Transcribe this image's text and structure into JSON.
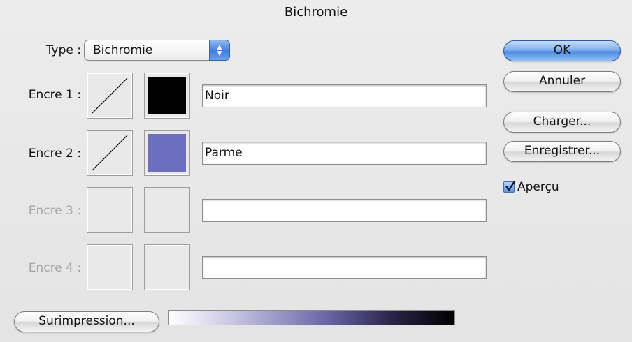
{
  "dialog": {
    "title": "Bichromie"
  },
  "type_row": {
    "label": "Type :",
    "selected": "Bichromie"
  },
  "inks": [
    {
      "label": "Encre 1 :",
      "name": "Noir",
      "color": "#000000",
      "enabled": true
    },
    {
      "label": "Encre 2 :",
      "name": "Parme",
      "color": "#6b6fbd",
      "enabled": true
    },
    {
      "label": "Encre 3 :",
      "name": "",
      "color": "",
      "enabled": false
    },
    {
      "label": "Encre 4 :",
      "name": "",
      "color": "",
      "enabled": false
    }
  ],
  "buttons": {
    "ok": "OK",
    "cancel": "Annuler",
    "load": "Charger...",
    "save": "Enregistrer...",
    "overprint": "Surimpression..."
  },
  "preview": {
    "label": "Aperçu",
    "checked": true
  },
  "colors": {
    "accent": "#4d8ae0",
    "disabled_text": "#a6a6a6"
  }
}
